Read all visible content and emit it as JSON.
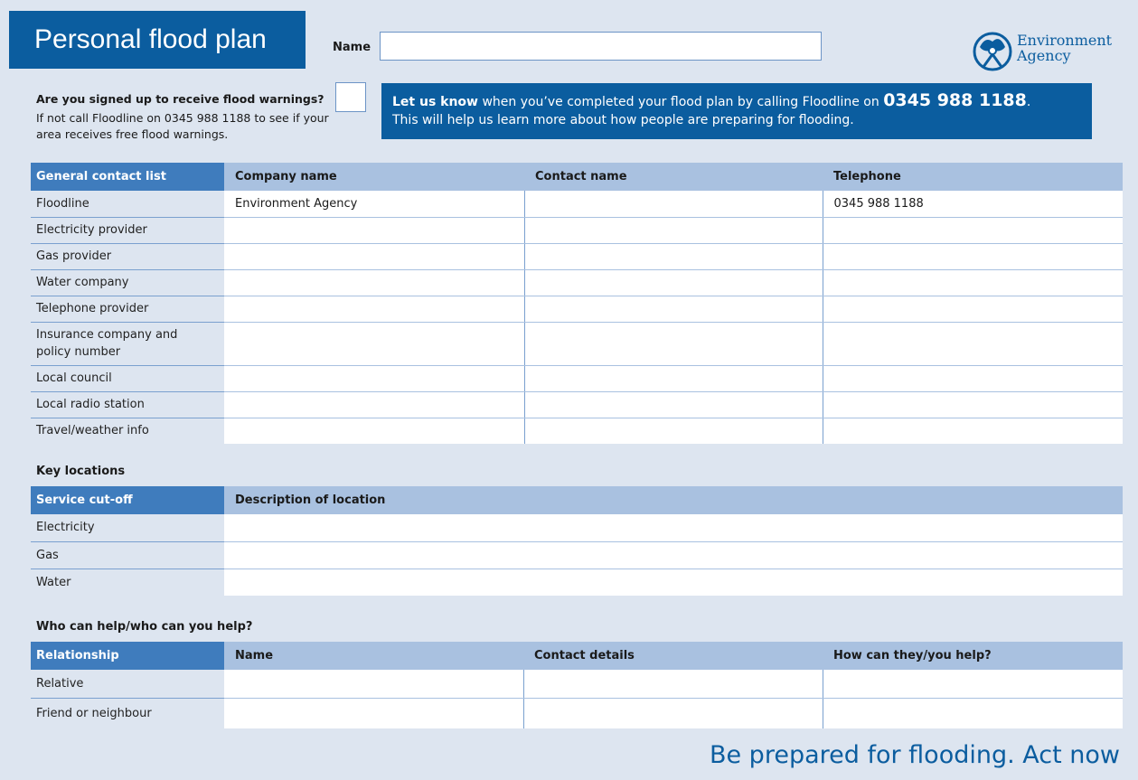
{
  "header": {
    "title": "Personal flood plan",
    "name_label": "Name",
    "name_value": "",
    "logo_line1": "Environment",
    "logo_line2": "Agency"
  },
  "warnings": {
    "question": "Are you signed up to receive flood warnings?",
    "subtext": "If not call Floodline on 0345 988 1188 to see if your area receives free flood warnings.",
    "checked": false
  },
  "banner": {
    "bold": "Let us know",
    "text1": " when you’ve completed your flood plan by calling Floodline on ",
    "number": "0345 988 1188",
    "text2": ".",
    "line2": "This will help us learn more about how people are preparing for flooding."
  },
  "contacts": {
    "headers": [
      "General contact list",
      "Company name",
      "Contact name",
      "Telephone"
    ],
    "rows": [
      {
        "label": "Floodline",
        "company": "Environment Agency",
        "contact": "",
        "telephone": "0345 988 1188"
      },
      {
        "label": "Electricity provider",
        "company": "",
        "contact": "",
        "telephone": ""
      },
      {
        "label": "Gas provider",
        "company": "",
        "contact": "",
        "telephone": ""
      },
      {
        "label": "Water company",
        "company": "",
        "contact": "",
        "telephone": ""
      },
      {
        "label": "Telephone provider",
        "company": "",
        "contact": "",
        "telephone": ""
      },
      {
        "label": "Insurance company and",
        "label2": "policy number",
        "company": "",
        "contact": "",
        "telephone": ""
      },
      {
        "label": "Local council",
        "company": "",
        "contact": "",
        "telephone": ""
      },
      {
        "label": "Local radio station",
        "company": "",
        "contact": "",
        "telephone": ""
      },
      {
        "label": "Travel/weather info",
        "company": "",
        "contact": "",
        "telephone": ""
      }
    ]
  },
  "locations": {
    "title": "Key locations",
    "headers": [
      "Service cut-off",
      "Description of location"
    ],
    "rows": [
      {
        "label": "Electricity",
        "description": ""
      },
      {
        "label": "Gas",
        "description": ""
      },
      {
        "label": "Water",
        "description": ""
      }
    ]
  },
  "helpers": {
    "title": "Who can help/who can you help?",
    "headers": [
      "Relationship",
      "Name",
      "Contact details",
      "How can they/you help?"
    ],
    "rows": [
      {
        "label": "Relative",
        "name": "",
        "contact": "",
        "help": ""
      },
      {
        "label": "Friend or neighbour",
        "name": "",
        "contact": "",
        "help": ""
      }
    ]
  },
  "footer": {
    "slogan": "Be prepared for flooding. Act now"
  },
  "colors": {
    "brand_blue": "#0b5d9f",
    "header_blue": "#3f7cbd",
    "header_light": "#a9c1e0",
    "background": "#dde5f0"
  }
}
